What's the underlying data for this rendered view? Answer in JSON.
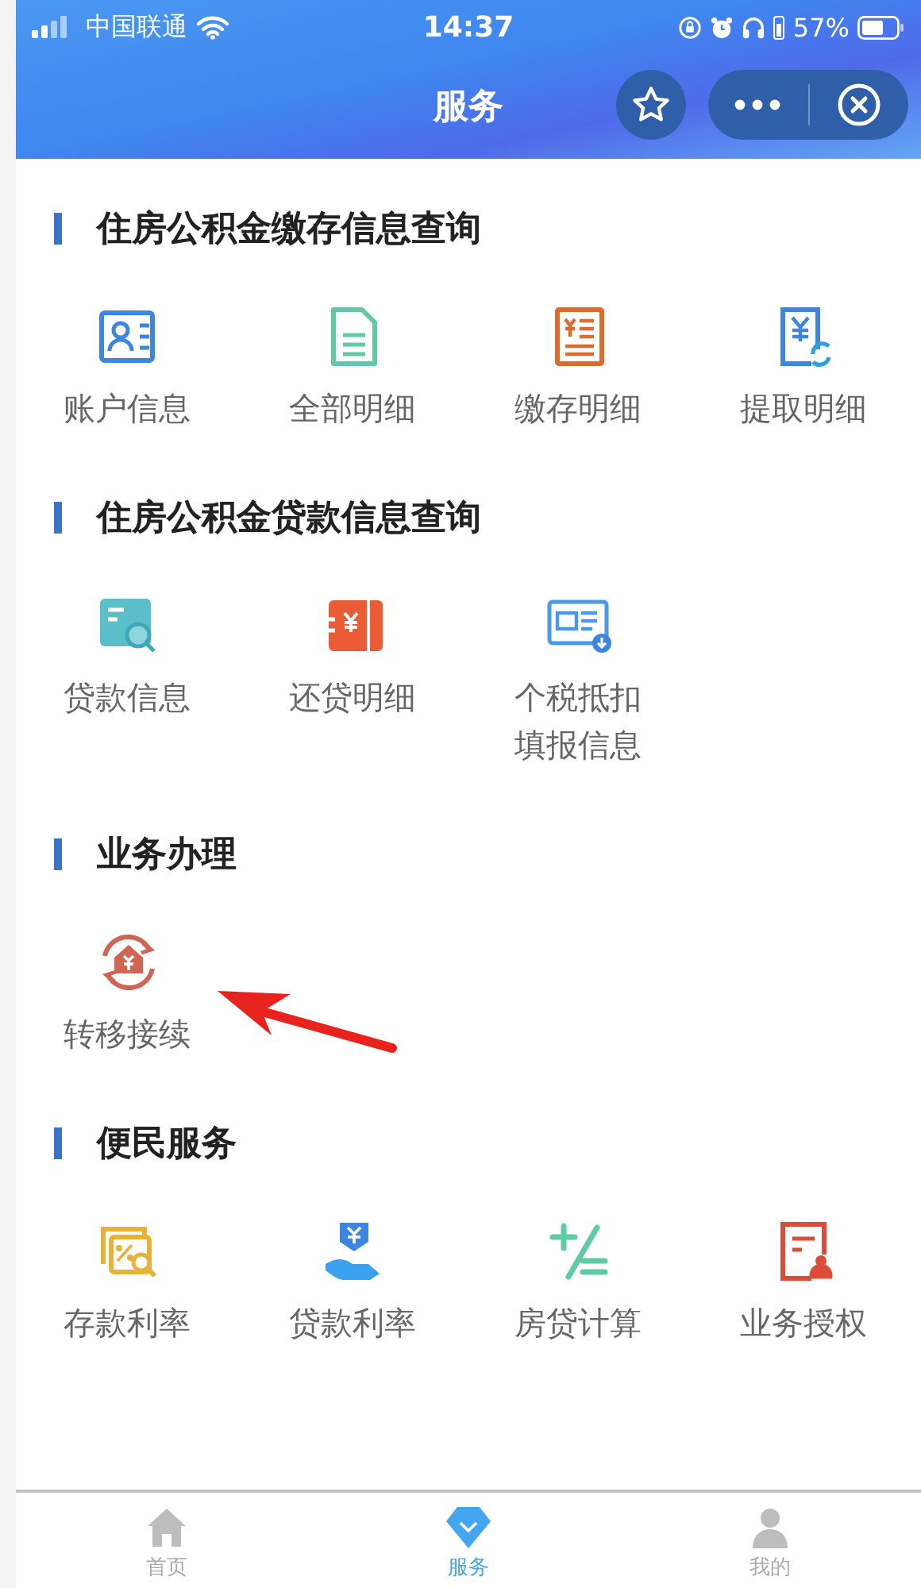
{
  "status_bar": {
    "carrier": "中国联通",
    "time": "14:37",
    "battery": "57%"
  },
  "header": {
    "title": "服务"
  },
  "sections": [
    {
      "title": "住房公积金缴存信息查询",
      "items": [
        {
          "label": "账户信息"
        },
        {
          "label": "全部明细"
        },
        {
          "label": "缴存明细"
        },
        {
          "label": "提取明细"
        }
      ]
    },
    {
      "title": "住房公积金贷款信息查询",
      "items": [
        {
          "label": "贷款信息"
        },
        {
          "label": "还贷明细"
        },
        {
          "label": "个税抵扣填报信息"
        }
      ]
    },
    {
      "title": "业务办理",
      "items": [
        {
          "label": "转移接续"
        }
      ]
    },
    {
      "title": "便民服务",
      "items": [
        {
          "label": "存款利率"
        },
        {
          "label": "贷款利率"
        },
        {
          "label": "房贷计算"
        },
        {
          "label": "业务授权"
        }
      ]
    }
  ],
  "tab_bar": [
    {
      "label": "首页",
      "selected": false
    },
    {
      "label": "服务",
      "selected": true
    },
    {
      "label": "我的",
      "selected": false
    }
  ]
}
